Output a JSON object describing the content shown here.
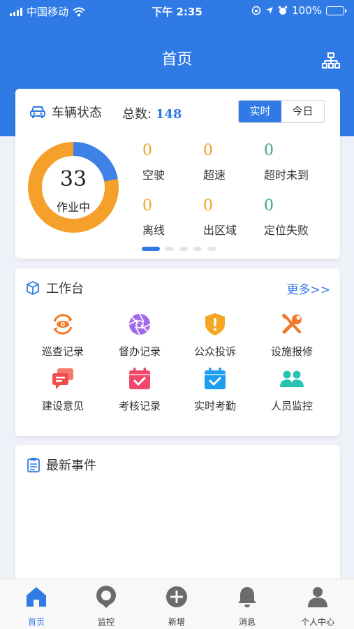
{
  "status_bar": {
    "carrier": "中国移动",
    "time": "下午 2:35",
    "battery": "100%"
  },
  "nav": {
    "title": "首页"
  },
  "vehicle_status": {
    "title": "车辆状态",
    "total_label": "总数:",
    "total_value": "148",
    "toggle_realtime": "实时",
    "toggle_today": "今日",
    "donut_value": "33",
    "donut_label": "作业中",
    "donut_progress": 0.22,
    "stats": [
      {
        "value": "0",
        "label": "空驶"
      },
      {
        "value": "0",
        "label": "超速"
      },
      {
        "value": "0",
        "label": "超时未到"
      },
      {
        "value": "0",
        "label": "离线"
      },
      {
        "value": "0",
        "label": "出区域"
      },
      {
        "value": "0",
        "label": "定位失败"
      }
    ],
    "pager": {
      "total": 5,
      "active": 1
    }
  },
  "workbench": {
    "title": "工作台",
    "more": "更多>>",
    "tools": [
      {
        "label": "巡查记录",
        "icon": "eye-sync-icon",
        "color": "#f07a28"
      },
      {
        "label": "督办记录",
        "icon": "aperture-icon",
        "color": "#a16ae8"
      },
      {
        "label": "公众投诉",
        "icon": "shield-alert-icon",
        "color": "#f5a623"
      },
      {
        "label": "设施报修",
        "icon": "wrench-icon",
        "color": "#f07a28"
      },
      {
        "label": "建设意见",
        "icon": "chat-bubbles-icon",
        "color": "#f04e4e"
      },
      {
        "label": "考核记录",
        "icon": "calendar-check-icon",
        "color": "#f0476b"
      },
      {
        "label": "实时考勤",
        "icon": "calendar-check-icon",
        "color": "#1e9df2"
      },
      {
        "label": "人员监控",
        "icon": "users-icon",
        "color": "#27c2b0"
      }
    ]
  },
  "events": {
    "title": "最新事件"
  },
  "tabbar": {
    "items": [
      {
        "label": "首页",
        "active": true
      },
      {
        "label": "监控",
        "active": false
      },
      {
        "label": "新增",
        "active": false
      },
      {
        "label": "消息",
        "active": false
      },
      {
        "label": "个人中心",
        "active": false
      }
    ]
  },
  "colors": {
    "primary": "#2f7ae5",
    "donut_active": "#3d82e6",
    "donut_rest": "#f5a02a",
    "stat_orange": "#f5a02a",
    "stat_teal": "#3aa58b"
  }
}
